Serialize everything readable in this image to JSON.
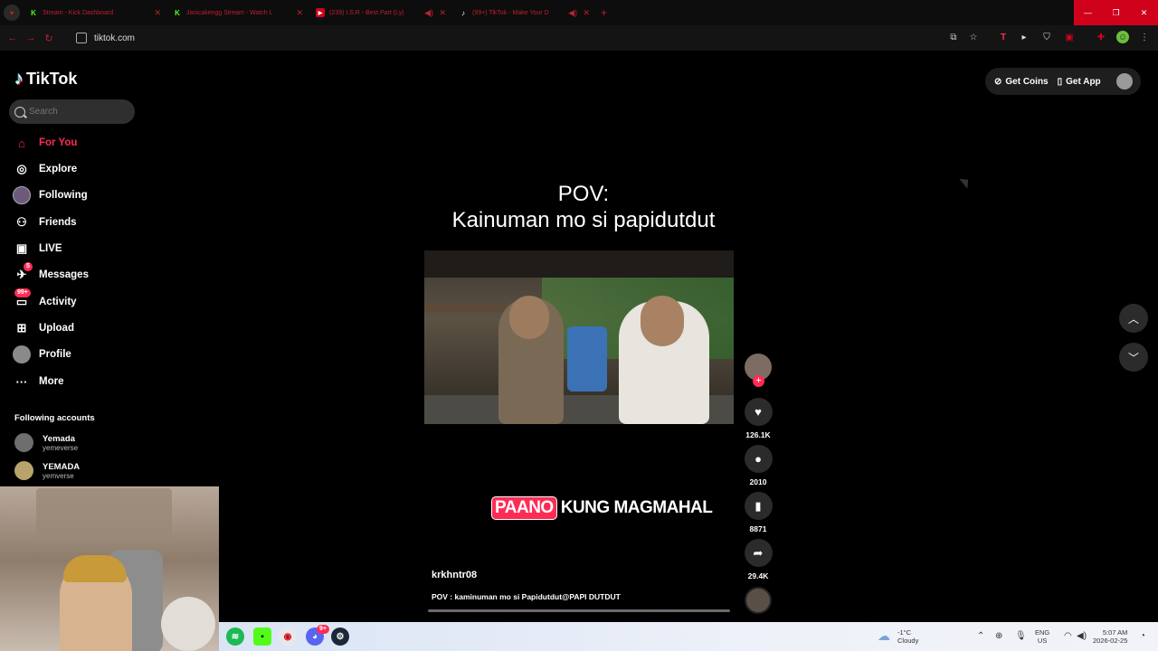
{
  "browser": {
    "tabs": [
      {
        "title": "Stream - Kick Dashboard",
        "favicon": "K"
      },
      {
        "title": "Janicakengg Stream - Watch L",
        "favicon": "K"
      },
      {
        "title": "(239) I.S.R - Best Part (Ly)",
        "favicon": "yt"
      },
      {
        "title": "(99+) TikTok - Make Your D",
        "favicon": "tt"
      }
    ],
    "new_tab": "+",
    "url": "tiktok.com",
    "accent_color": "#c01e2e"
  },
  "tiktok": {
    "logo_text": "TikTok",
    "search_placeholder": "Search",
    "nav": [
      {
        "label": "For You",
        "icon": "home-icon"
      },
      {
        "label": "Explore",
        "icon": "compass-icon"
      },
      {
        "label": "Following",
        "icon": "following-avatar-icon"
      },
      {
        "label": "Friends",
        "icon": "friends-icon"
      },
      {
        "label": "LIVE",
        "icon": "live-icon"
      },
      {
        "label": "Messages",
        "icon": "messages-icon",
        "badge": "5"
      },
      {
        "label": "Activity",
        "icon": "activity-icon",
        "badge": "99+"
      },
      {
        "label": "Upload",
        "icon": "upload-icon"
      },
      {
        "label": "Profile",
        "icon": "profile-avatar-icon"
      },
      {
        "label": "More",
        "icon": "more-icon"
      }
    ],
    "following_heading": "Following accounts",
    "following_accounts": [
      {
        "name": "Yemada",
        "handle": "yemeverse"
      },
      {
        "name": "YEMADA",
        "handle": "yemverse"
      }
    ],
    "header": {
      "get_coins": "Get Coins",
      "get_app": "Get App"
    },
    "video": {
      "title_line1": "POV:",
      "title_line2": "Kainuman mo si papidutdut",
      "banner_highlight": "PAANO",
      "banner_rest": "KUNG MAGMAHAL",
      "author": "krkhntr08",
      "description": "POV : kaminuman mo si Papidutdut@PAPI DUTDUT",
      "likes": "126.1K",
      "comments": "2010",
      "saves": "8871",
      "shares": "29.4K"
    },
    "brand_color": "#fe2c55"
  },
  "taskbar": {
    "weather_temp": "-1°C",
    "weather_desc": "Cloudy",
    "lang": "ENG",
    "region": "US",
    "time": "5:07 AM",
    "date": "2026-02-25",
    "discord_badge": "9+"
  }
}
